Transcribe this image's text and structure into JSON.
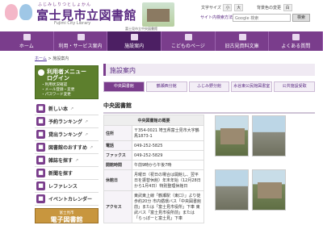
{
  "header": {
    "logo_ruby": "ふじみしりつとしょかん",
    "logo": "富士見市立図書館",
    "logo_en": "Fujimi City Library",
    "building_note": "富士見市立中央図書館",
    "font_size_label": "文字サイズ",
    "font_small": "小",
    "font_large": "大",
    "bg_color_label": "背景色の変更",
    "bg_color_value": "白",
    "site_nav": "サイト内検索方法",
    "search_placeholder": "Google 検索",
    "search_button": "検索"
  },
  "nav": [
    {
      "label": "ホーム"
    },
    {
      "label": "利用・サービス案内"
    },
    {
      "label": "施設案内"
    },
    {
      "label": "こどものページ"
    },
    {
      "label": "旧古見資料文庫"
    },
    {
      "label": "よくある質問"
    }
  ],
  "breadcrumb": {
    "home": "ホーム",
    "sep": " > ",
    "current": "施設案内"
  },
  "sidebar": {
    "login_title_1": "利用者メニュー",
    "login_title_2": "ログイン",
    "login_items": [
      "・利用状況確認",
      "・メール登録・変更",
      "・パスワード変更"
    ],
    "menu": [
      {
        "label": "新しい本",
        "arrow": "↗"
      },
      {
        "label": "予約ランキング",
        "arrow": "↗"
      },
      {
        "label": "貸出ランキング",
        "arrow": "↗"
      },
      {
        "label": "図書館のおすすめ",
        "arrow": "↗"
      },
      {
        "label": "雑誌を探す",
        "arrow": "↗"
      },
      {
        "label": "新聞を探す",
        "arrow": ""
      },
      {
        "label": "レファレンス",
        "arrow": ""
      },
      {
        "label": "イベントカレンダー",
        "arrow": ""
      }
    ],
    "ebook_small": "富士見市",
    "ebook": "電子図書館"
  },
  "main": {
    "page_title": "施設案内",
    "tabs": [
      "中央図書館",
      "鶴瀬西分館",
      "ふじみ野分館",
      "水谷東公民館図書室",
      "公共施設受取"
    ],
    "section_title": "中央図書館",
    "table": {
      "caption": "中央図書館の概要",
      "rows": [
        {
          "label": "住所",
          "value": "〒354-0021 埼玉県富士見市大字鶴馬1873-1"
        },
        {
          "label": "電話",
          "value": "049-252-5825"
        },
        {
          "label": "ファックス",
          "value": "049-252-5829"
        },
        {
          "label": "開館時間",
          "value": "午前9時から午後7時"
        },
        {
          "label": "休館日",
          "value": "月曜日（祝日の場合は開館し、翌平日を振替休館）年末年始（12月28日から1月4日）特別整理休館日"
        },
        {
          "label": "アクセス",
          "value": "東武東上線「鶴瀬駅（東口）」より徒歩約20分 市内循環バス「中央図書館前」または「富士見市役所」下車 東武バス「富士見市役所前」または「らっぽーと富士見」下車"
        }
      ]
    }
  }
}
